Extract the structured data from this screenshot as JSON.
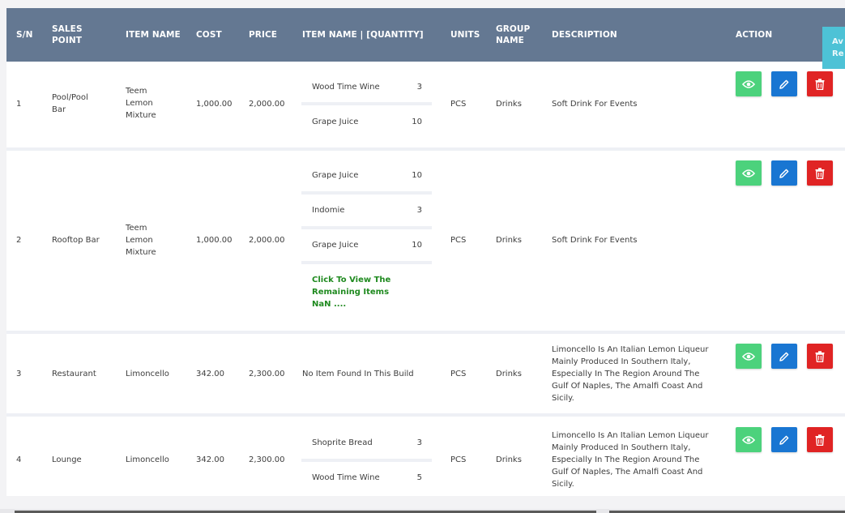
{
  "columns": {
    "sn": "S/N",
    "sales_point_1": "SALES",
    "sales_point_2": "POINT",
    "item_name": "ITEM NAME",
    "cost": "COST",
    "price": "PRICE",
    "item_qty": "ITEM NAME | [QUANTITY]",
    "units": "UNITS",
    "group_name_1": "GROUP",
    "group_name_2": "NAME",
    "description": "DESCRIPTION",
    "action": "ACTION"
  },
  "side_tab": {
    "line1": "Av",
    "line2": "Re"
  },
  "rows": [
    {
      "sn": "1",
      "sales_point": [
        "Pool/Pool",
        "Bar"
      ],
      "item_name": [
        "Teem",
        "Lemon",
        "Mixture"
      ],
      "cost": "1,000.00",
      "price": "2,000.00",
      "items": [
        {
          "name": "Wood Time Wine",
          "qty": "3"
        },
        {
          "name": "Grape Juice",
          "qty": "10"
        }
      ],
      "units": "PCS",
      "group": "Drinks",
      "description": [
        "Soft Drink For Events"
      ]
    },
    {
      "sn": "2",
      "sales_point": [
        "Rooftop Bar"
      ],
      "item_name": [
        "Teem",
        "Lemon",
        "Mixture"
      ],
      "cost": "1,000.00",
      "price": "2,000.00",
      "items": [
        {
          "name": "Grape Juice",
          "qty": "10"
        },
        {
          "name": "Indomie",
          "qty": "3"
        },
        {
          "name": "Grape Juice",
          "qty": "10"
        }
      ],
      "more_link": [
        "Click To View The",
        "Remaining Items",
        "NaN ...."
      ],
      "units": "PCS",
      "group": "Drinks",
      "description": [
        "Soft Drink For Events"
      ]
    },
    {
      "sn": "3",
      "sales_point": [
        "Restaurant"
      ],
      "item_name": [
        "Limoncello"
      ],
      "cost": "342.00",
      "price": "2,300.00",
      "no_items": "No Item Found In This Build",
      "units": "PCS",
      "group": "Drinks",
      "description": [
        "Limoncello Is An Italian Lemon Liqueur",
        "Mainly Produced In Southern Italy,",
        "Especially In The Region Around The",
        "Gulf Of Naples, The Amalfi Coast And",
        "Sicily."
      ]
    },
    {
      "sn": "4",
      "sales_point": [
        "Lounge"
      ],
      "item_name": [
        "Limoncello"
      ],
      "cost": "342.00",
      "price": "2,300.00",
      "items": [
        {
          "name": "Shoprite Bread",
          "qty": "3"
        },
        {
          "name": "Wood Time Wine",
          "qty": "5"
        }
      ],
      "units": "PCS",
      "group": "Drinks",
      "description": [
        "Limoncello Is An Italian Lemon Liqueur",
        "Mainly Produced In Southern Italy,",
        "Especially In The Region Around The",
        "Gulf Of Naples, The Amalfi Coast And",
        "Sicily."
      ]
    }
  ],
  "icons": {
    "view": "eye-icon",
    "edit": "pencil-icon",
    "delete": "trash-icon"
  },
  "colors": {
    "header_bg": "#647892",
    "view_btn": "#4cd27c",
    "edit_btn": "#1976d2",
    "delete_btn": "#e02424",
    "link": "#1f8a1f",
    "side_tab": "#4dc2d6"
  }
}
